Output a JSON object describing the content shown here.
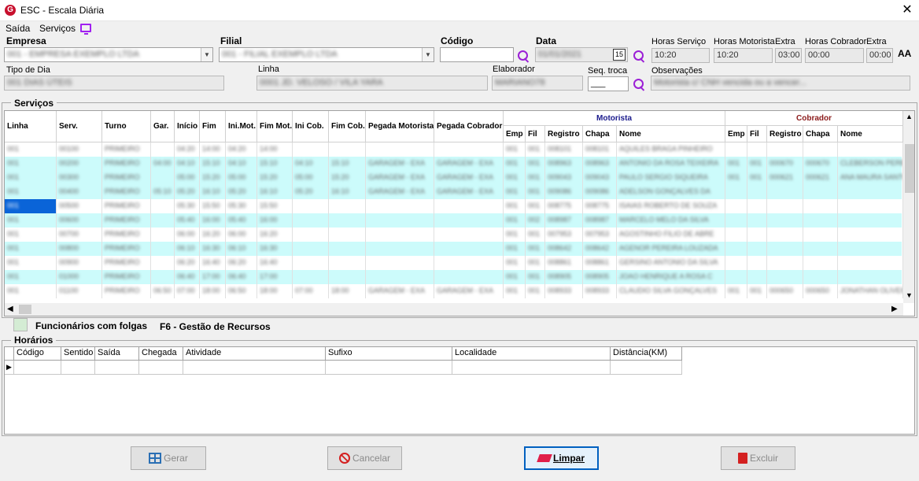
{
  "window": {
    "title": "ESC - Escala Diária",
    "logo": "G",
    "close": "✕"
  },
  "menu": {
    "items": [
      "Saída",
      "Serviços"
    ],
    "monitor_icon": "monitor-icon"
  },
  "form": {
    "empresa_label": "Empresa",
    "empresa_value": "001 - EMPRESA EXEMPLO LTDA",
    "filial_label": "Filial",
    "filial_value": "001 - FILIAL EXEMPLO LTDA",
    "codigo_label": "Código",
    "codigo_value": "",
    "data_label": "Data",
    "data_value": "01/01/2021",
    "calendar_day": "15",
    "horas_servico_label": "Horas Serviço",
    "horas_servico_value": "10:20",
    "horas_motorista_label": "Horas Motorista",
    "horas_motorista_value": "10:20",
    "extra_label": "Extra",
    "extra_motorista_value": "03:00",
    "horas_cobrador_label": "Horas Cobrador",
    "horas_cobrador_value": "00:00",
    "extra_cobrador_label": "Extra",
    "extra_cobrador_value": "00:00",
    "font_icon": "AA",
    "tipo_dia_label": "Tipo de Dia",
    "tipo_dia_value": "001 DIAS ÚTEIS",
    "linha_label": "Linha",
    "linha_value": "0001 JD. VELOSO / VILA YARA",
    "elaborador_label": "Elaborador",
    "elaborador_value": "MARIANO78",
    "seq_troca_label": "Seq. troca",
    "seq_troca_value": "___",
    "observacoes_label": "Observações",
    "observacoes_value": "Motorista c/ CNH vencida ou a vencer..."
  },
  "servicos": {
    "title": "Serviços",
    "motorista_group": "Motorista",
    "cobrador_group": "Cobrador",
    "columns": [
      "Linha",
      "Serv.",
      "Turno",
      "Gar.",
      "Início",
      "Fim",
      "Ini.Mot.",
      "Fim Mot.",
      "Ini Cob.",
      "Fim Cob.",
      "Pegada Motorista",
      "Pegada Cobrador"
    ],
    "mot_columns": [
      "Emp",
      "Fil",
      "Registro",
      "Chapa",
      "Nome"
    ],
    "cob_columns": [
      "Emp",
      "Fil",
      "Registro",
      "Chapa",
      "Nome"
    ],
    "rows": [
      {
        "linha": "001",
        "serv": "00100",
        "turno": "PRIMEIRO",
        "gar": "",
        "ini": "04:20",
        "fim": "14:00",
        "im": "04:20",
        "fm": "14:00",
        "ic": "",
        "fc": "",
        "pm": "",
        "pc": "",
        "me": "001",
        "mf": "001",
        "mr": "008101",
        "mc": "008101",
        "mn": "AQUILES BRAGA PINHEIRO",
        "ce": "",
        "cf": "",
        "cr": "",
        "cc": "",
        "cn": ""
      },
      {
        "linha": "001",
        "serv": "00200",
        "turno": "PRIMEIRO",
        "gar": "04:00",
        "ini": "04:10",
        "fim": "15:10",
        "im": "04:10",
        "fm": "15:10",
        "ic": "04:10",
        "fc": "15:10",
        "pm": "GARAGEM - EXA",
        "pc": "GARAGEM - EXA",
        "me": "001",
        "mf": "001",
        "mr": "008963",
        "mc": "008963",
        "mn": "ANTONIO DA ROSA TEIXEIRA",
        "ce": "001",
        "cf": "001",
        "cr": "000670",
        "cc": "000670",
        "cn": "CLEBERSON PEREIRA"
      },
      {
        "linha": "001",
        "serv": "00300",
        "turno": "PRIMEIRO",
        "gar": "",
        "ini": "05:00",
        "fim": "15:20",
        "im": "05:00",
        "fm": "15:20",
        "ic": "05:00",
        "fc": "15:20",
        "pm": "GARAGEM - EXA",
        "pc": "GARAGEM - EXA",
        "me": "001",
        "mf": "001",
        "mr": "009043",
        "mc": "009043",
        "mn": "PAULO SERGIO SIQUEIRA",
        "ce": "001",
        "cf": "001",
        "cr": "000621",
        "cc": "000621",
        "cn": "ANA MAURA SANTOS"
      },
      {
        "linha": "001",
        "serv": "00400",
        "turno": "PRIMEIRO",
        "gar": "05:10",
        "ini": "05:20",
        "fim": "16:10",
        "im": "05:20",
        "fm": "16:10",
        "ic": "05:20",
        "fc": "16:10",
        "pm": "GARAGEM - EXA",
        "pc": "GARAGEM - EXA",
        "me": "001",
        "mf": "001",
        "mr": "009086",
        "mc": "009086",
        "mn": "ADELSON GONÇALVES DA",
        "ce": "",
        "cf": "",
        "cr": "",
        "cc": "",
        "cn": ""
      },
      {
        "linha": "001",
        "serv": "00500",
        "turno": "PRIMEIRO",
        "gar": "",
        "ini": "05:30",
        "fim": "15:50",
        "im": "05:30",
        "fm": "15:50",
        "ic": "",
        "fc": "",
        "pm": "",
        "pc": "",
        "me": "001",
        "mf": "001",
        "mr": "008775",
        "mc": "008775",
        "mn": "ISAIAS ROBERTO DE SOUZA",
        "ce": "",
        "cf": "",
        "cr": "",
        "cc": "",
        "cn": ""
      },
      {
        "linha": "001",
        "serv": "00600",
        "turno": "PRIMEIRO",
        "gar": "",
        "ini": "05:40",
        "fim": "16:00",
        "im": "05:40",
        "fm": "16:00",
        "ic": "",
        "fc": "",
        "pm": "",
        "pc": "",
        "me": "001",
        "mf": "002",
        "mr": "008987",
        "mc": "008987",
        "mn": "MARCELO MELO DA SILVA",
        "ce": "",
        "cf": "",
        "cr": "",
        "cc": "",
        "cn": ""
      },
      {
        "linha": "001",
        "serv": "00700",
        "turno": "PRIMEIRO",
        "gar": "",
        "ini": "06:00",
        "fim": "16:20",
        "im": "06:00",
        "fm": "16:20",
        "ic": "",
        "fc": "",
        "pm": "",
        "pc": "",
        "me": "001",
        "mf": "001",
        "mr": "007953",
        "mc": "007953",
        "mn": "AGOSTINHO FILIO DE ABRE",
        "ce": "",
        "cf": "",
        "cr": "",
        "cc": "",
        "cn": ""
      },
      {
        "linha": "001",
        "serv": "00800",
        "turno": "PRIMEIRO",
        "gar": "",
        "ini": "06:10",
        "fim": "16:30",
        "im": "06:10",
        "fm": "16:30",
        "ic": "",
        "fc": "",
        "pm": "",
        "pc": "",
        "me": "001",
        "mf": "001",
        "mr": "008642",
        "mc": "008642",
        "mn": "AGENOR PEREIRA LOUZADA",
        "ce": "",
        "cf": "",
        "cr": "",
        "cc": "",
        "cn": ""
      },
      {
        "linha": "001",
        "serv": "00900",
        "turno": "PRIMEIRO",
        "gar": "",
        "ini": "06:20",
        "fim": "16:40",
        "im": "06:20",
        "fm": "16:40",
        "ic": "",
        "fc": "",
        "pm": "",
        "pc": "",
        "me": "001",
        "mf": "001",
        "mr": "008861",
        "mc": "008861",
        "mn": "GERSINO ANTONIO DA SILVA",
        "ce": "",
        "cf": "",
        "cr": "",
        "cc": "",
        "cn": ""
      },
      {
        "linha": "001",
        "serv": "01000",
        "turno": "PRIMEIRO",
        "gar": "",
        "ini": "06:40",
        "fim": "17:00",
        "im": "06:40",
        "fm": "17:00",
        "ic": "",
        "fc": "",
        "pm": "",
        "pc": "",
        "me": "001",
        "mf": "001",
        "mr": "008905",
        "mc": "008905",
        "mn": "JOAO HENRIQUE A ROSA C",
        "ce": "",
        "cf": "",
        "cr": "",
        "cc": "",
        "cn": ""
      },
      {
        "linha": "001",
        "serv": "01100",
        "turno": "PRIMEIRO",
        "gar": "06:50",
        "ini": "07:00",
        "fim": "18:00",
        "im": "06:50",
        "fm": "18:00",
        "ic": "07:00",
        "fc": "18:00",
        "pm": "GARAGEM - EXA",
        "pc": "GARAGEM - EXA",
        "me": "001",
        "mf": "001",
        "mr": "008933",
        "mc": "008933",
        "mn": "CLAUDIO SILVA GONÇALVES",
        "ce": "001",
        "cf": "001",
        "cr": "000650",
        "cc": "000650",
        "cn": "JONATHAN OLIVEIRA"
      }
    ]
  },
  "legend": {
    "folgas": "Funcionários com folgas",
    "f6": "F6 - Gestão de Recursos"
  },
  "horarios": {
    "title": "Horários",
    "columns": [
      "Código",
      "Sentido",
      "Saída",
      "Chegada",
      "Atividade",
      "Sufixo",
      "Localidade",
      "Distância(KM)"
    ]
  },
  "buttons": {
    "gerar": "Gerar",
    "cancelar": "Cancelar",
    "limpar": "Limpar",
    "excluir": "Excluir"
  },
  "colors": {
    "row_alt": "#ccfbfb",
    "motorista": "#1a1a8c",
    "cobrador": "#8b1a1a",
    "accent": "#9b1fd6",
    "selected": "#0a64d8"
  }
}
